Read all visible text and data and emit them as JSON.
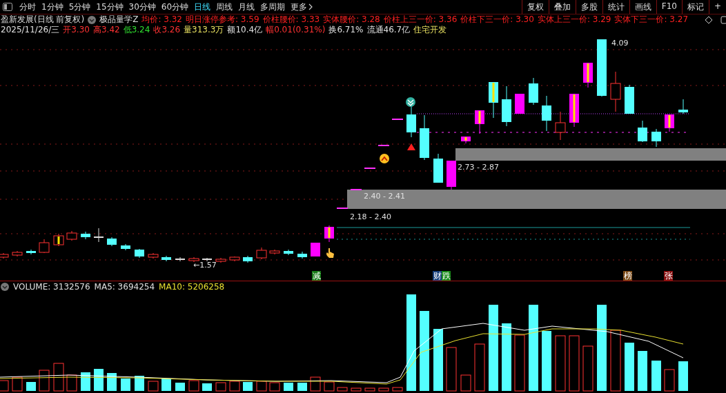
{
  "toolbar": {
    "periods": [
      {
        "label": "分时",
        "selected": false
      },
      {
        "label": "1分钟",
        "selected": false
      },
      {
        "label": "5分钟",
        "selected": false
      },
      {
        "label": "15分钟",
        "selected": false
      },
      {
        "label": "30分钟",
        "selected": false
      },
      {
        "label": "60分钟",
        "selected": false
      },
      {
        "label": "日线",
        "selected": true
      },
      {
        "label": "周线",
        "selected": false
      },
      {
        "label": "月线",
        "selected": false
      },
      {
        "label": "多周期",
        "selected": false
      },
      {
        "label": "更多",
        "selected": false
      }
    ],
    "buttons": [
      "复权",
      "叠加",
      "多股",
      "统计",
      "画线",
      "F10",
      "标记",
      "+"
    ]
  },
  "title": "盈新发展(日线 前复权)",
  "indicator": "极品量学Z",
  "indicator_values": [
    "均价: 3.32",
    "明日涨停参考: 3.59",
    "价柱腰价: 3.33",
    "实体腰价: 3.28",
    "价柱上三一价: 3.36",
    "价柱下三一价: 3.30",
    "实体上三一价: 3.29",
    "实体下三一价: 3.27"
  ],
  "quote": [
    {
      "text": "2025/11/26/三",
      "color": "#e0e0e0"
    },
    {
      "text": "开3.30",
      "color": "#ff3232"
    },
    {
      "text": "高3.42",
      "color": "#ff3232"
    },
    {
      "text": "低3.24",
      "color": "#30e030"
    },
    {
      "text": "收3.26",
      "color": "#ff3232"
    },
    {
      "text": "量313.3万",
      "color": "#e8e060"
    },
    {
      "text": "额10.4亿",
      "color": "#e0e0e0"
    },
    {
      "text": "幅0.01(0.31%)",
      "color": "#ff3232"
    },
    {
      "text": "换6.71%",
      "color": "#e0e0e0"
    },
    {
      "text": "流通46.7亿",
      "color": "#e0e0e0"
    },
    {
      "text": "住宅开发",
      "color": "#e8e060"
    }
  ],
  "chart_labels": [
    "4.09",
    "←1.57",
    "2.73 - 2.87",
    "2.40 - 2.41",
    "2.18 - 2.40"
  ],
  "markers": [
    {
      "text": "减",
      "color": "#177a17"
    },
    {
      "text": "财",
      "color": "#173f7a"
    },
    {
      "text": "跌",
      "color": "#178a17"
    },
    {
      "text": "榜",
      "color": "#7a4a17"
    },
    {
      "text": "张",
      "color": "#8a1212"
    }
  ],
  "volume_header": [
    {
      "text": "VOLUME: 3132576",
      "color": "#e0e0e0"
    },
    {
      "text": "MA5: 3694254",
      "color": "#e0e0e0"
    },
    {
      "text": "MA10: 5206258",
      "color": "#e8e030"
    }
  ]
}
